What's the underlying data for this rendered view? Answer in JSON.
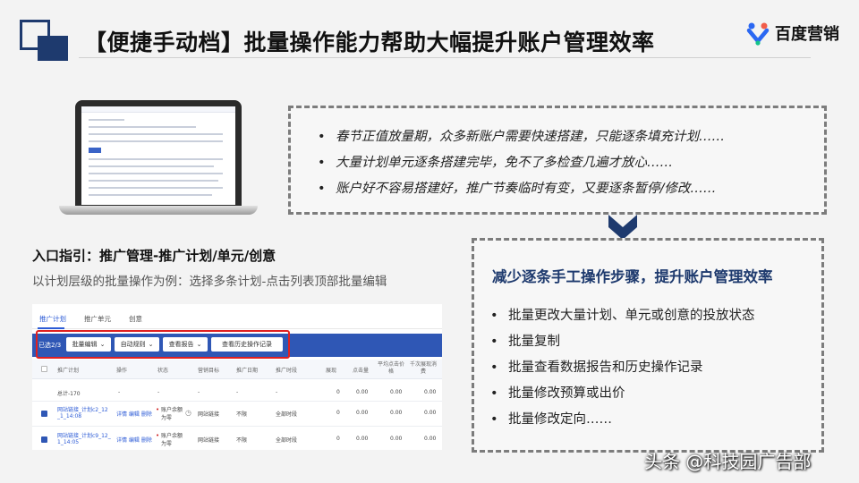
{
  "slide": {
    "title": "【便捷手动档】批量操作能力帮助大幅提升账户管理效率",
    "logo_text": "百度营销"
  },
  "pain_points": [
    "春节正值放量期，众多新账户需要快速搭建，只能逐条填充计划……",
    "大量计划单元逐条搭建完毕，免不了多检查几遍才放心……",
    "账户好不容易搭建好，推广节奏临时有变，又要逐条暂停/修改……"
  ],
  "benefits": {
    "heading": "减少逐条手工操作步骤，提升账户管理效率",
    "items": [
      "批量更改大量计划、单元或创意的投放状态",
      "批量复制",
      "批量查看数据报告和历史操作记录",
      "批量修改预算或出价",
      "批量修改定向……"
    ]
  },
  "entry": {
    "title": "入口指引：推广管理-推广计划/单元/创意",
    "subtitle": "以计划层级的批量操作为例：选择多条计划-点击列表顶部批量编辑"
  },
  "ui_screenshot": {
    "tabs": [
      "推广计划",
      "推广单元",
      "创意"
    ],
    "selected_label": "已选2/3",
    "toolbar_buttons": [
      "批量编辑",
      "自动规则",
      "查看报告",
      "查看历史操作记录"
    ],
    "columns": [
      "推广计划",
      "操作",
      "状态",
      "营销目标",
      "推广日期",
      "推广时段",
      "展现",
      "点击量",
      "平均点击价格",
      "千次展现消费"
    ],
    "summary": {
      "name": "总计-170",
      "dash": "-",
      "values": [
        "0",
        "0.00",
        "0.00",
        "0.00"
      ]
    },
    "rows": [
      {
        "name_line1": "网站链接_计划c2_12",
        "name_line2": "_1_14:08",
        "actions": "详情  编辑  删除",
        "status_line1": "账户余额",
        "status_line2": "为零",
        "goal": "网站链接",
        "date": "不限",
        "period": "全部时段",
        "values": [
          "0",
          "0.00",
          "0.00",
          "0.00"
        ]
      },
      {
        "name_line1": "网站链接_计划c9_12_",
        "name_line2": "1_14:05",
        "actions": "详情  编辑  删除",
        "status_line1": "账户余额",
        "status_line2": "为零",
        "goal": "网站链接",
        "date": "不限",
        "period": "全部时段",
        "values": [
          "0",
          "0.00",
          "0.00",
          "0.00"
        ]
      }
    ]
  },
  "watermark": "头条 @科技园广告部",
  "colors": {
    "accent": "#1e3a6e",
    "toolbar": "#2f57b5",
    "highlight": "#e02020"
  }
}
